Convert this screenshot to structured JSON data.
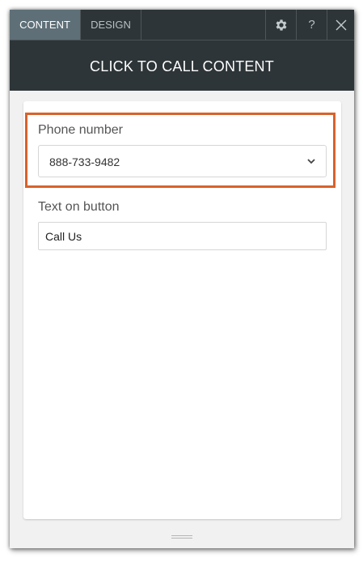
{
  "tabs": [
    {
      "label": "CONTENT",
      "active": true
    },
    {
      "label": "DESIGN",
      "active": false
    }
  ],
  "toolbar": {
    "settings_icon": "gear-icon",
    "help_label": "?",
    "close_icon": "close-icon"
  },
  "header": {
    "title": "CLICK TO CALL CONTENT"
  },
  "form": {
    "phone_label": "Phone number",
    "phone_value": "888-733-9482",
    "button_text_label": "Text on button",
    "button_text_value": "Call Us"
  },
  "colors": {
    "header_bg": "#2e3538",
    "active_tab_bg": "#5e6f77",
    "highlight": "#d9622b",
    "panel_bg": "#f1f1f1"
  }
}
